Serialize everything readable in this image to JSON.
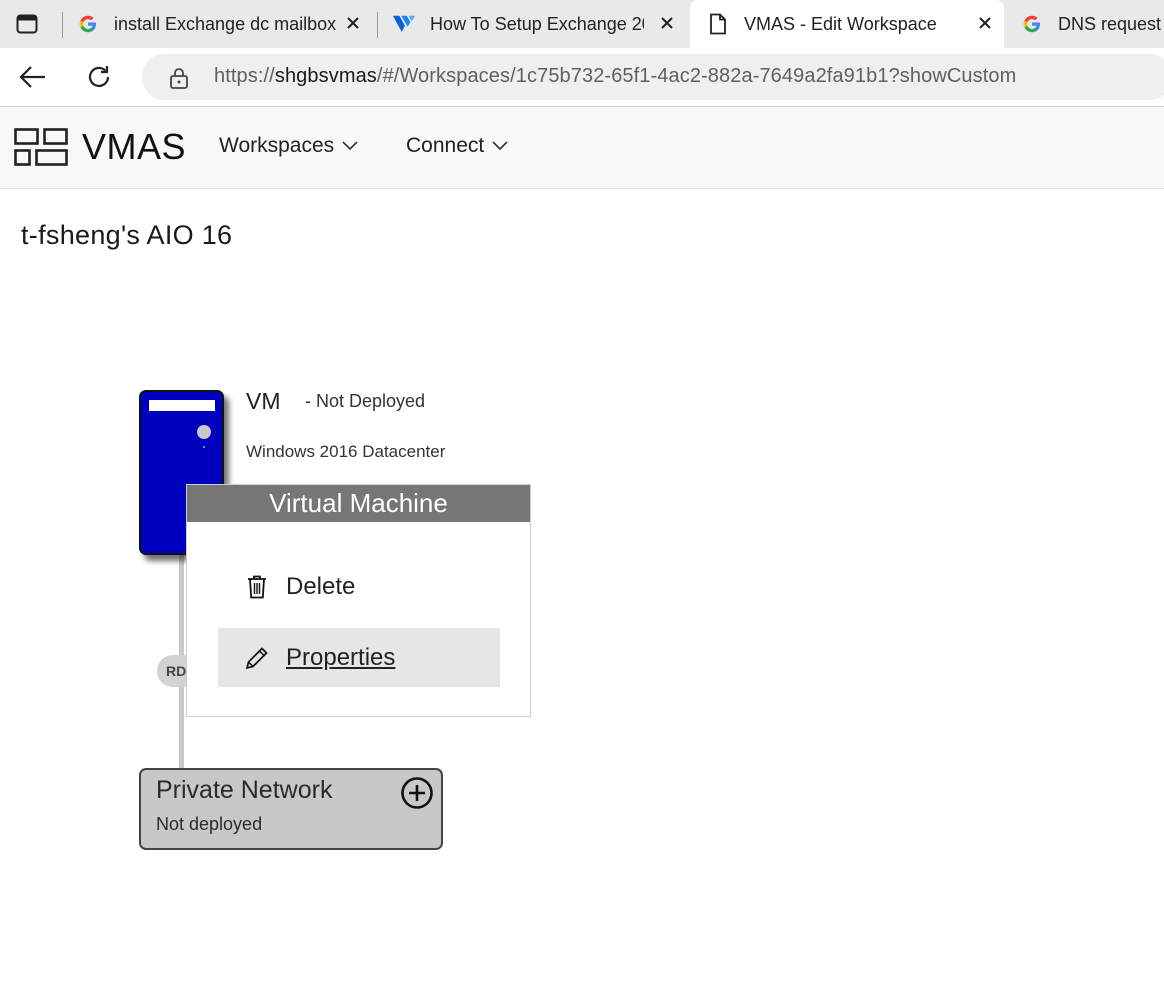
{
  "browser": {
    "tabs": [
      {
        "title": "install Exchange dc mailbox",
        "favicon": "google-icon",
        "active": false
      },
      {
        "title": "How To Setup Exchange 20",
        "favicon": "vultr-icon",
        "active": false
      },
      {
        "title": "VMAS - Edit Workspace",
        "favicon": "page-icon",
        "active": true
      },
      {
        "title": "DNS request",
        "favicon": "google-icon",
        "active": false
      }
    ],
    "url_scheme": "https://",
    "url_host": "shgbsvmas",
    "url_path": "/#/Workspaces/1c75b732-65f1-4ac2-882a-7649a2fa91b1?showCustom"
  },
  "app": {
    "name": "VMAS",
    "menus": [
      {
        "label": "Workspaces"
      },
      {
        "label": "Connect"
      }
    ]
  },
  "workspace": {
    "title": "t-fsheng's AIO 16",
    "vm": {
      "name": "VM",
      "status": "- Not Deployed",
      "os": "Windows 2016 Datacenter",
      "color": "#0000c0"
    },
    "connector_label": "RD",
    "network": {
      "name": "Private Network",
      "status": "Not deployed"
    }
  },
  "context_menu": {
    "header": "Virtual Machine",
    "items": [
      {
        "label": "Delete",
        "icon": "trash-icon"
      },
      {
        "label": "Properties",
        "icon": "pencil-icon",
        "hovered": true
      }
    ]
  },
  "colors": {
    "menu_header": "#767676",
    "hover": "#e6e6e6",
    "network_fill": "#c8c8c8"
  }
}
